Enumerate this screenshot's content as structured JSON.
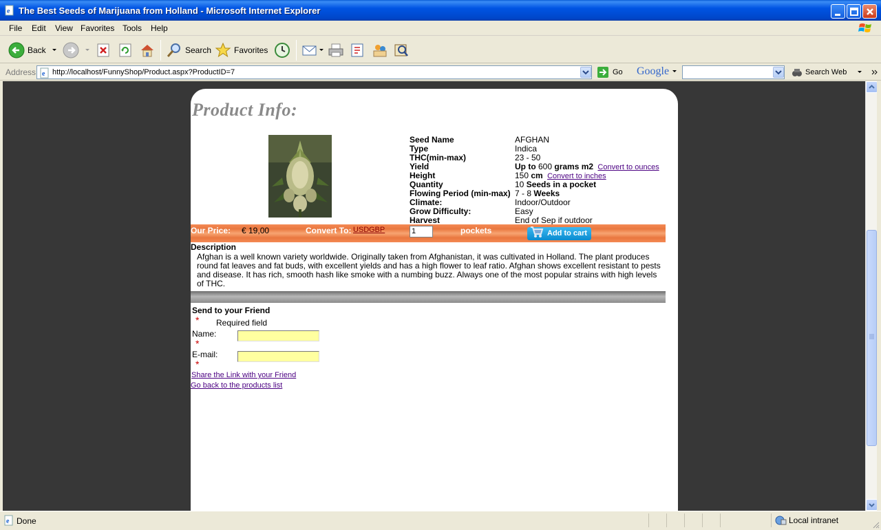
{
  "window": {
    "title": "The Best Seeds of Marijuana from Holland - Microsoft Internet Explorer"
  },
  "menu": [
    "File",
    "Edit",
    "View",
    "Favorites",
    "Tools",
    "Help"
  ],
  "toolbar": {
    "back": "Back",
    "search": "Search",
    "favorites": "Favorites"
  },
  "address": {
    "label": "Address",
    "url": "http://localhost/FunnyShop/Product.aspx?ProductID=7",
    "go": "Go",
    "google": "Google",
    "search_web": "Search Web"
  },
  "product": {
    "heading": "Product Info:",
    "specs": [
      {
        "key": "Seed Name",
        "value": "AFGHAN"
      },
      {
        "key": "Type",
        "value": "Indica"
      },
      {
        "key": "THC(min-max)",
        "value": "23 - 50"
      },
      {
        "key": "Yield",
        "value_bold_prefix": "Up to",
        "value": "600",
        "value_bold_suffix": "grams m2",
        "link": "Convert to ounces"
      },
      {
        "key": "Height",
        "value": "150",
        "value_bold_suffix": "cm",
        "link": "Convert to inches"
      },
      {
        "key": "Quantity",
        "value": "10",
        "value_bold_suffix": "Seeds in a pocket"
      },
      {
        "key": "Flowing Period (min-max)",
        "value": "7 - 8",
        "value_bold_suffix": "Weeks"
      },
      {
        "key": "Climate:",
        "value": "Indoor/Outdoor"
      },
      {
        "key": "Grow Difficulty:",
        "value": "Easy"
      },
      {
        "key": "Harvest",
        "value": "End of Sep if outdoor"
      }
    ],
    "price_label": "Our Price:",
    "price": "€ 19,00",
    "convert_label": "Convert To:",
    "convert_usd": "USD",
    "convert_gbp": "GBP",
    "quantity_value": "1",
    "pockets_label": "pockets",
    "add_to_cart": "Add to cart",
    "description_title": "Description",
    "description": "Afghan is a well known variety worldwide. Originally taken from Afghanistan, it was cultivated in Holland. The plant produces round fat leaves and fat buds, with excellent yields and has a high flower to leaf ratio. Afghan shows excellent resistant to pests and disease. It has rich, smooth hash like smoke with a numbing buzz. Always one of the most popular strains with high levels of THC."
  },
  "friend": {
    "title": "Send to your Friend",
    "required": "Required field",
    "star": "*",
    "name_label": "Name:",
    "email_label": "E-mail:",
    "share_link": "Share the Link with your Friend",
    "back_link": "Go back to the products list"
  },
  "status": {
    "text": "Done",
    "zone": "Local intranet"
  }
}
